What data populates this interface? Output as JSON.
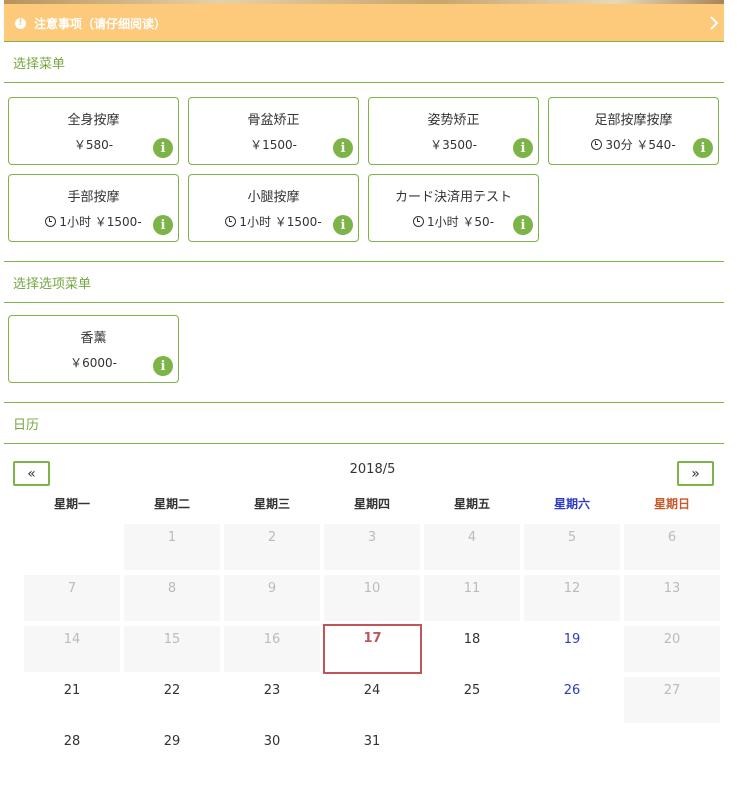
{
  "notice": {
    "text": "注意事项（请仔细阅读）",
    "icon": "exclamation-circle-icon"
  },
  "sections": {
    "menu": "选择菜单",
    "options": "选择选项菜单",
    "calendar": "日历"
  },
  "menu_items": [
    {
      "name": "全身按摩",
      "info": "￥580-"
    },
    {
      "name": "骨盆矫正",
      "info": "￥1500-"
    },
    {
      "name": "姿势矫正",
      "info": "￥3500-"
    },
    {
      "name": "足部按摩按摩",
      "info": "30分 ￥540-"
    },
    {
      "name": "手部按摩",
      "info": "1小时 ￥1500-"
    },
    {
      "name": "小腿按摩",
      "info": "1小时 ￥1500-"
    },
    {
      "name": "カード決済用テスト",
      "info": "1小时 ￥50-"
    }
  ],
  "option_items": [
    {
      "name": "香薰",
      "info": "￥6000-"
    }
  ],
  "calendar": {
    "month": "2018/5",
    "prev": "«",
    "next": "»",
    "weekdays": [
      "星期一",
      "星期二",
      "星期三",
      "星期四",
      "星期五",
      "星期六",
      "星期日"
    ],
    "days": {
      "d1": "1",
      "d2": "2",
      "d3": "3",
      "d4": "4",
      "d5": "5",
      "d6": "6",
      "d7": "7",
      "d8": "8",
      "d9": "9",
      "d10": "10",
      "d11": "11",
      "d12": "12",
      "d13": "13",
      "d14": "14",
      "d15": "15",
      "d16": "16",
      "d17": "17",
      "d18": "18",
      "d19": "19",
      "d20": "20",
      "d21": "21",
      "d22": "22",
      "d23": "23",
      "d24": "24",
      "d25": "25",
      "d26": "26",
      "d27": "27",
      "d28": "28",
      "d29": "29",
      "d30": "30",
      "d31": "31"
    },
    "today": "17"
  },
  "colors": {
    "accent": "#7cb447",
    "notice": "#fdc97b",
    "saturday": "#2d3bc2",
    "sunday": "#c8582a",
    "today": "#c0565a"
  }
}
